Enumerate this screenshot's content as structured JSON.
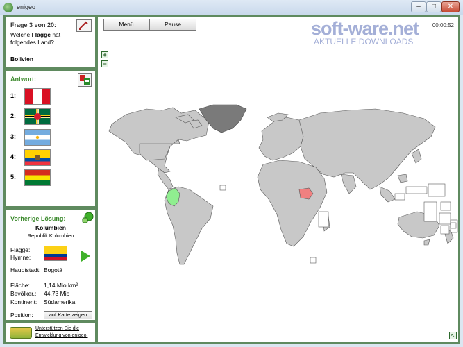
{
  "window": {
    "title": "enigeo",
    "minimize": "–",
    "maximize": "□",
    "close": "✕"
  },
  "question": {
    "title": "Frage 3 von 20:",
    "text_before": "Welche ",
    "text_bold": "Flagge",
    "text_after": " hat folgendes Land?",
    "country": "Bolivien"
  },
  "answers": {
    "title": "Antwort:",
    "items": [
      {
        "num": "1:",
        "flag": "peru"
      },
      {
        "num": "2:",
        "flag": "dominica"
      },
      {
        "num": "3:",
        "flag": "argentina"
      },
      {
        "num": "4:",
        "flag": "ecuador"
      },
      {
        "num": "5:",
        "flag": "bolivia"
      }
    ]
  },
  "previous": {
    "title": "Vorherige Lösung:",
    "name": "Kolumbien",
    "full_name": "Republik Kolumbien",
    "flag_label": "Flagge:",
    "anthem_label": "Hymne:",
    "capital_label": "Hauptstadt:",
    "capital": "Bogotá",
    "area_label": "Fläche:",
    "area": "1,14 Mio km²",
    "population_label": "Bevölker.:",
    "population": "44,73 Mio",
    "continent_label": "Kontinent:",
    "continent": "Südamerika",
    "position_label": "Position:",
    "position_button": "auf Karte zeigen"
  },
  "support": {
    "text": "Unterstützen Sie die Entwicklung von enigeo."
  },
  "toolbar": {
    "menu": "Menü",
    "pause": "Pause",
    "timer": "00:00:52"
  },
  "watermark": {
    "line1": "soft-ware.net",
    "line2": "AKTUELLE DOWNLOADS"
  },
  "map": {
    "zoom_in": "+",
    "zoom_out": "−",
    "expand": "↖",
    "colors": {
      "land": "#c8c8c8",
      "border": "#595959",
      "highlight_green": "#90ee90",
      "highlight_red": "#f08080",
      "greenland": "#7a7a7a"
    }
  },
  "colors": {
    "accent": "#3d8a2e",
    "frame": "#5f8a5f"
  }
}
